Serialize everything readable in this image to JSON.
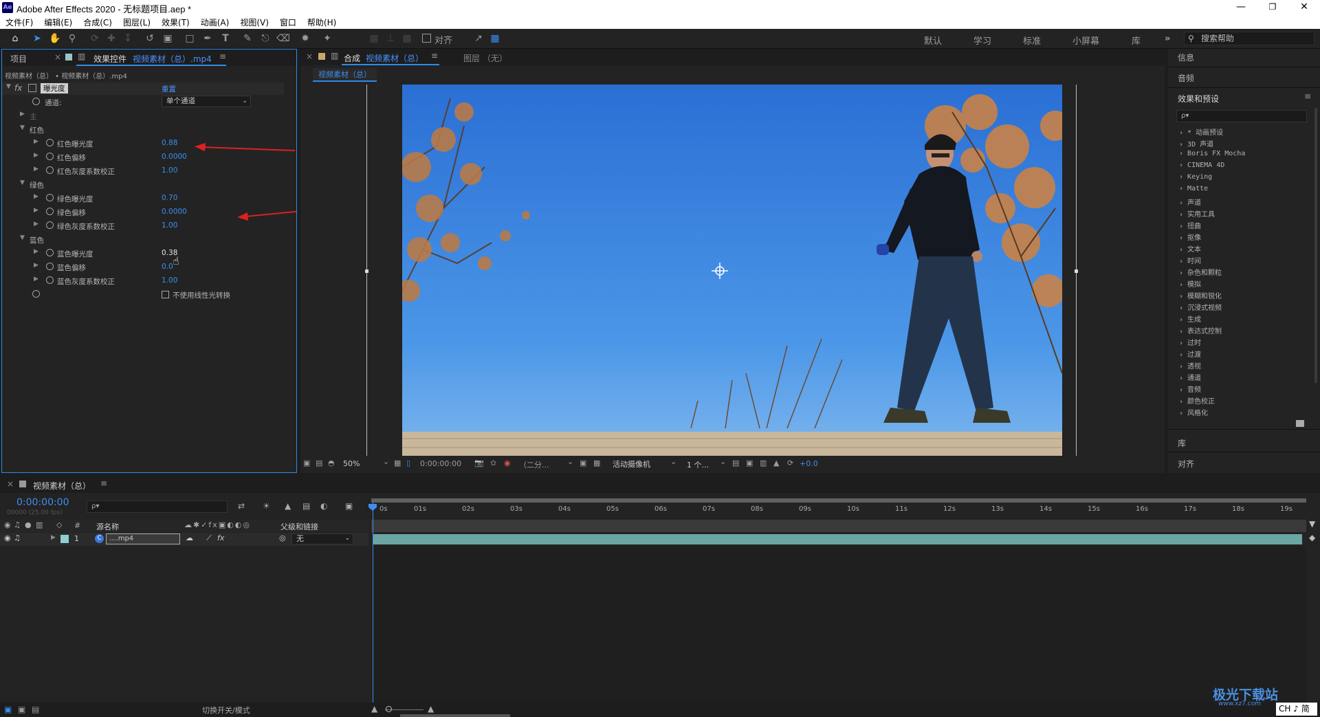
{
  "window": {
    "title": "Adobe After Effects 2020 - 无标题项目.aep *",
    "logo": "Ae",
    "controls": [
      "minimize-icon",
      "restore-icon",
      "close-icon"
    ]
  },
  "menu": [
    "文件(F)",
    "编辑(E)",
    "合成(C)",
    "图层(L)",
    "效果(T)",
    "动画(A)",
    "视图(V)",
    "窗口",
    "帮助(H)"
  ],
  "toolbar": {
    "snap_label": "对齐",
    "workspaces": [
      "默认",
      "学习",
      "标准",
      "小屏幕",
      "库"
    ],
    "search_placeholder": "搜索帮助"
  },
  "effects_panel": {
    "tab_project": "项目",
    "tab_label": "效果控件",
    "tab_source": "视频素材（总）.mp4",
    "breadcrumb": "视频素材（总） • 视频素材（总）.mp4",
    "effect_name": "曝光度",
    "reset": "重置",
    "channel_label": "通道:",
    "channel_value": "单个通道",
    "master_label": "主",
    "red_group": "红色",
    "red_exposure_label": "红色曝光度",
    "red_exposure": "0.88",
    "red_offset_label": "红色偏移",
    "red_offset": "0.0000",
    "red_gamma_label": "红色灰度系数校正",
    "red_gamma": "1.00",
    "green_group": "绿色",
    "green_exposure_label": "绿色曝光度",
    "green_exposure": "0.70",
    "green_offset_label": "绿色偏移",
    "green_offset": "0.0000",
    "green_gamma_label": "绿色灰度系数校正",
    "green_gamma": "1.00",
    "blue_group": "蓝色",
    "blue_exposure_label": "蓝色曝光度",
    "blue_exposure": "0.38",
    "blue_offset_label": "蓝色偏移",
    "blue_offset": "0.0",
    "blue_gamma_label": "蓝色灰度系数校正",
    "blue_gamma": "1.00",
    "linear_label": "不使用线性光转换"
  },
  "comp_panel": {
    "tab_label": "合成",
    "tab_name": "视频素材（总）",
    "layer_tab": "图层 （无）",
    "subtab": "视频素材（总）",
    "zoom": "50%",
    "timecode": "0:00:00:00",
    "resolution": "（二分...",
    "camera": "活动摄像机",
    "views": "1 个...",
    "exposure": "+0.0"
  },
  "right_panel": {
    "info": "信息",
    "audio": "音频",
    "effects_presets": "效果和预设",
    "search_placeholder": "ρ▾",
    "categories": [
      "* 动画预设",
      "3D 声道",
      "Boris FX Mocha",
      "CINEMA 4D",
      "Keying",
      "Matte",
      "声道",
      "实用工具",
      "扭曲",
      "抠像",
      "文本",
      "时间",
      "杂色和颗粒",
      "模拟",
      "模糊和锐化",
      "沉浸式视频",
      "生成",
      "表达式控制",
      "过时",
      "过渡",
      "透视",
      "通道",
      "音频",
      "颜色校正",
      "风格化"
    ],
    "library": "库",
    "align": "对齐"
  },
  "timeline": {
    "tab_name": "视频素材（总）",
    "timecode": "0:00:00:00",
    "fps": "00000 (25.00 fps)",
    "search_placeholder": "ρ▾",
    "col_num": "#",
    "col_source": "源名称",
    "col_parent": "父级和链接",
    "layer_index": "1",
    "layer_name": "....mp4",
    "parent_value": "无",
    "ruler": [
      "0s",
      "01s",
      "02s",
      "03s",
      "04s",
      "05s",
      "06s",
      "07s",
      "08s",
      "09s",
      "10s",
      "11s",
      "12s",
      "13s",
      "14s",
      "15s",
      "16s",
      "17s",
      "18s",
      "19s"
    ],
    "toggle_label": "切换开关/模式"
  },
  "watermark": {
    "brand": "极光下载站",
    "url": "www.xz7.com"
  },
  "ime_badge": "CH ♪ 简",
  "colors": {
    "accent": "#2d8ceb",
    "value_blue": "#3c8ff0",
    "panel_bg": "#232323",
    "layer_teal": "#6ba5a4"
  }
}
